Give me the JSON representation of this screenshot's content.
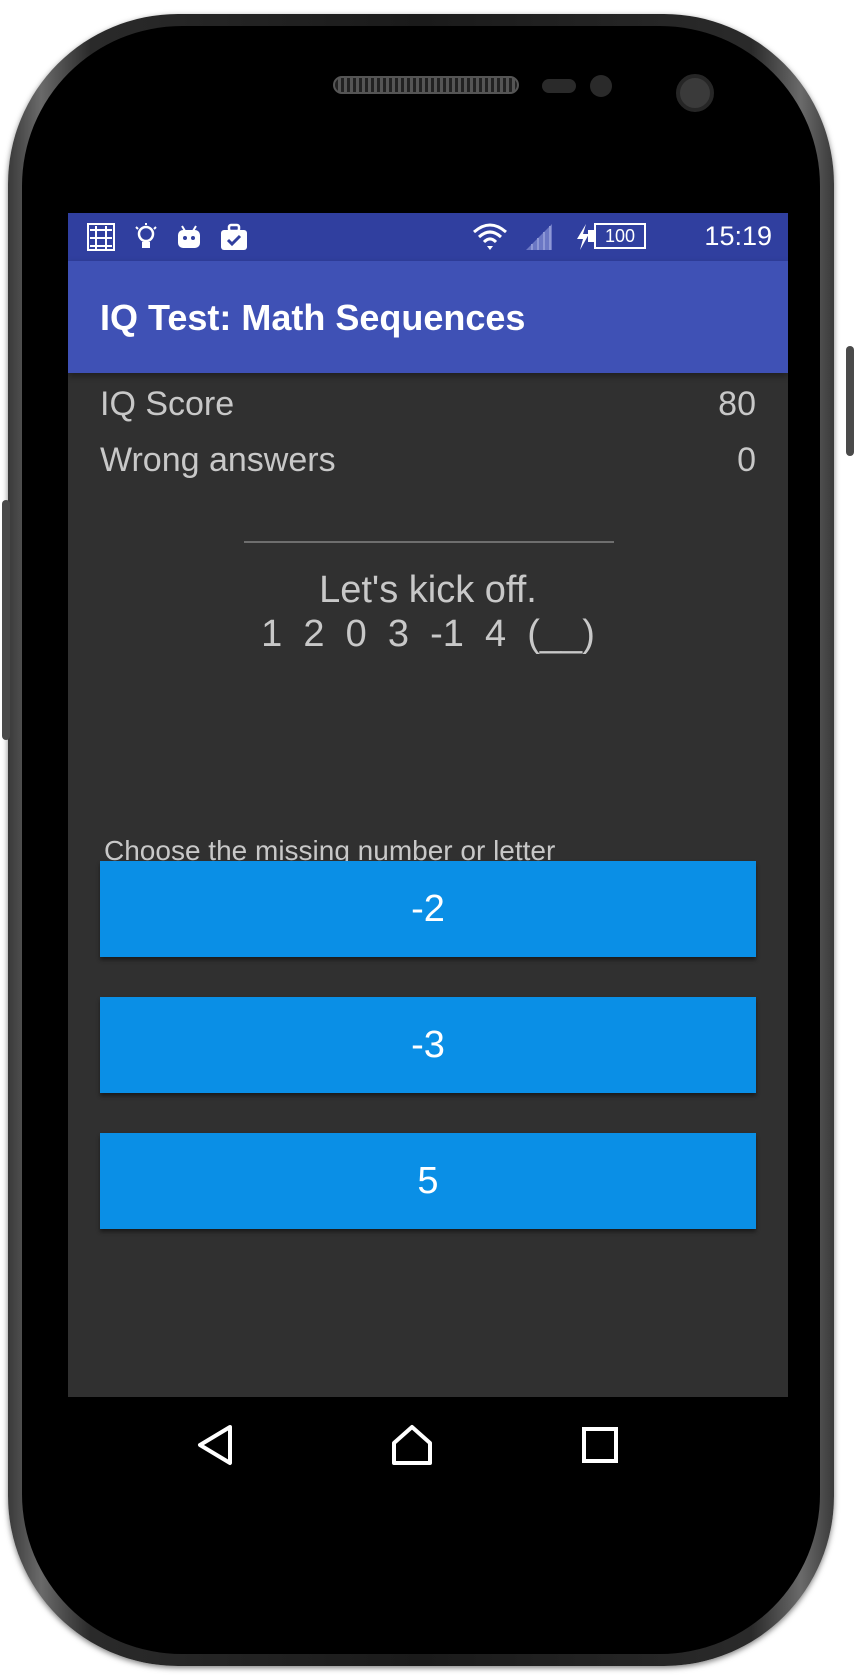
{
  "status_bar": {
    "time": "15:19",
    "battery": "100",
    "icons": [
      "notification-app-icon",
      "lightbulb-icon",
      "android-icon",
      "briefcase-check-icon",
      "wifi-icon",
      "signal-icon",
      "charging-icon",
      "battery-icon"
    ]
  },
  "app_bar": {
    "title": "IQ Test: Math Sequences"
  },
  "stats": {
    "iq_label": "IQ Score",
    "iq_value": "80",
    "wrong_label": "Wrong answers",
    "wrong_value": "0"
  },
  "question": {
    "intro": "Let's kick off.",
    "sequence": "1  2  0  3  -1  4  (__)"
  },
  "prompt": "Choose the missing number or letter",
  "answers": [
    {
      "label": "-2"
    },
    {
      "label": "-3"
    },
    {
      "label": "5"
    }
  ],
  "colors": {
    "status_bar": "#303f9f",
    "app_bar": "#3f51b5",
    "background": "#303030",
    "button": "#0a8fe6",
    "text": "#c8c8c8"
  },
  "nav_bar": {
    "icons": [
      "back-icon",
      "home-icon",
      "recents-icon"
    ]
  }
}
